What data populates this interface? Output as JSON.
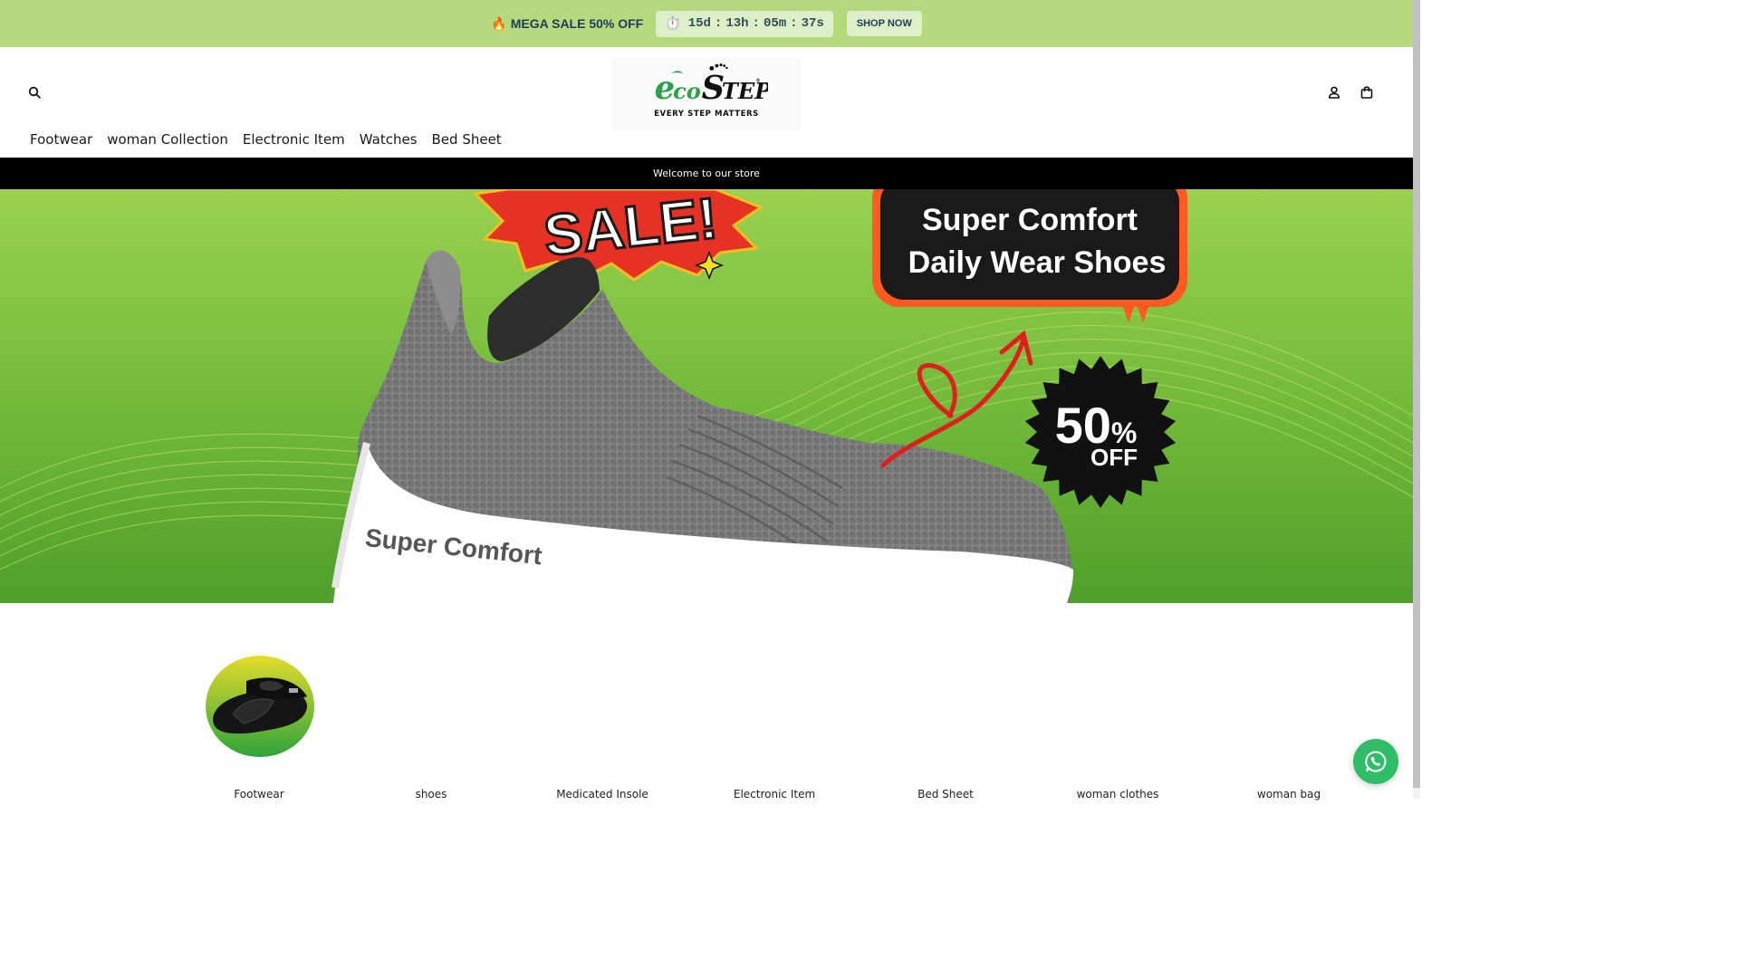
{
  "promo": {
    "flame_icon": "🔥",
    "text": "MEGA SALE 50% OFF",
    "timer_icon": "⏱️",
    "countdown": {
      "days": "15d",
      "hours": "13h",
      "minutes": "05m",
      "seconds": "37s",
      "separator": ":"
    },
    "shop_now_label": "SHOP NOW"
  },
  "header": {
    "icons": [
      "search-icon",
      "account-icon",
      "cart-icon"
    ],
    "logo": {
      "word": "ecoStep",
      "tagline": "EVERY STEP MATTERS",
      "registered": "®"
    },
    "nav": [
      "Footwear",
      "woman Collection",
      "Electronic Item",
      "Watches",
      "Bed Sheet"
    ]
  },
  "welcome_text": "Welcome to our store",
  "hero": {
    "sale_text": "SALE!",
    "headline_1": "Super Comfort",
    "headline_2": "Daily Wear Shoes",
    "discount_number": "50",
    "discount_percent": "%",
    "discount_off": "OFF",
    "shoe_text": "Super Comfort"
  },
  "categories": [
    "Footwear",
    "shoes",
    "Medicated Insole",
    "Electronic Item",
    "Bed Sheet",
    "woman clothes",
    "woman bag"
  ],
  "colors": {
    "promo_bg": "#b5d97c",
    "promo_text": "#1d3b5c",
    "hero_green": "#5fae34",
    "welcome_bg": "#000000",
    "whatsapp": "#2fbe68"
  }
}
